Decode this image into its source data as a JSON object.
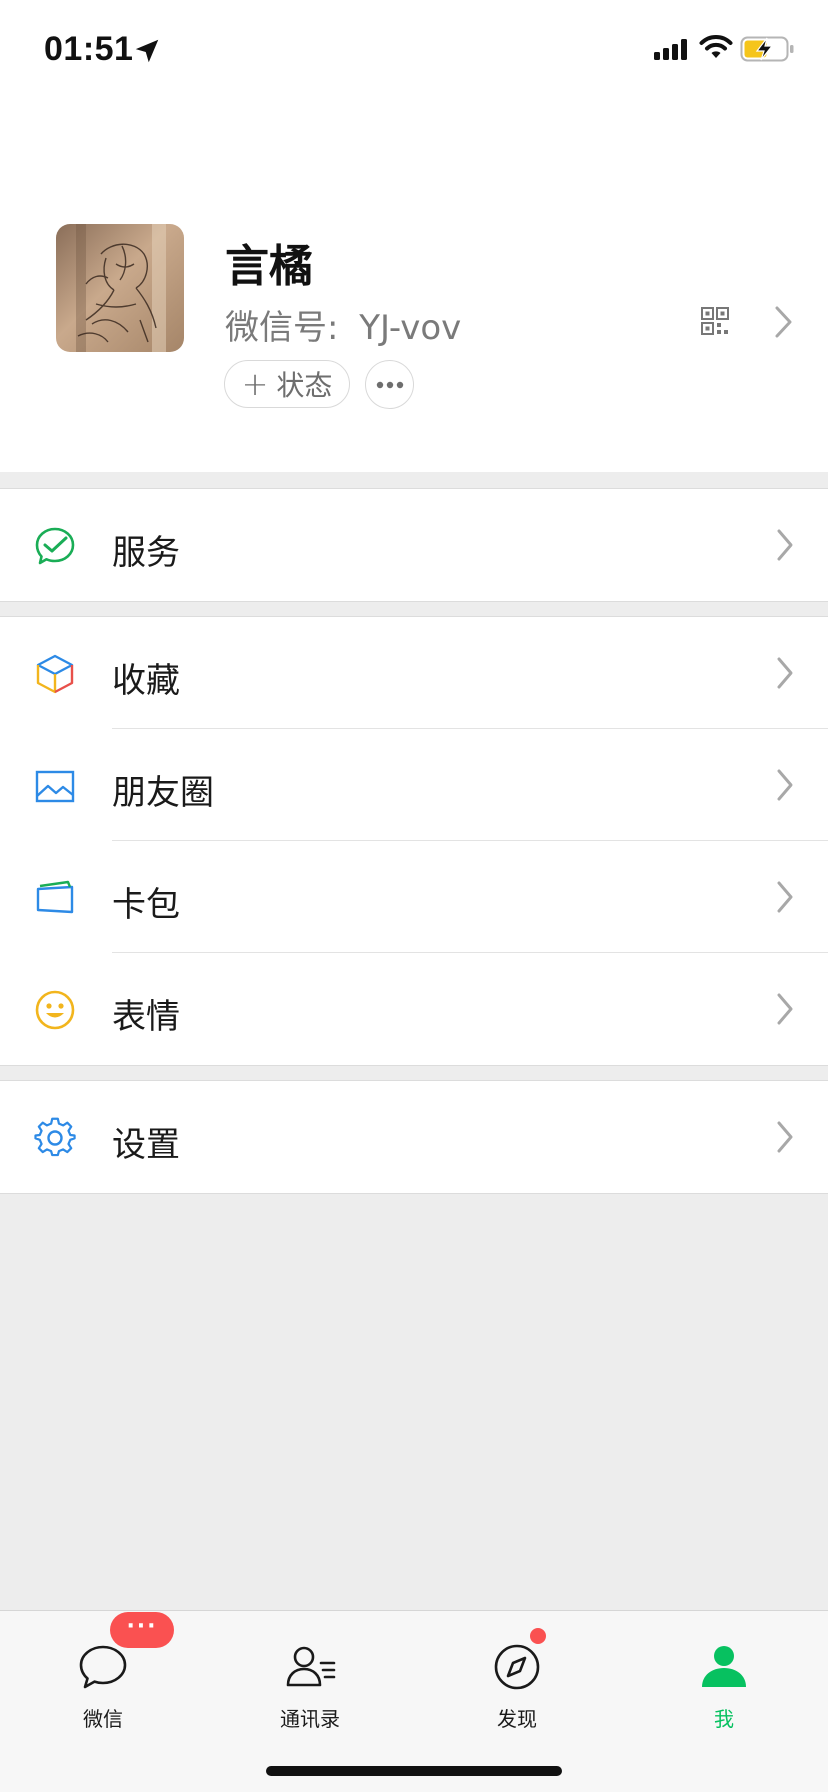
{
  "status_bar": {
    "time": "01:51"
  },
  "profile": {
    "nickname": "言橘",
    "wxid_label": "微信号:",
    "wxid_value": "YJ-vov",
    "status_button_label": "状态"
  },
  "menu": {
    "group1": [
      {
        "label": "服务",
        "icon": "wechat-pay-icon"
      }
    ],
    "group2": [
      {
        "label": "收藏",
        "icon": "favorites-cube-icon"
      },
      {
        "label": "朋友圈",
        "icon": "moments-picture-icon"
      },
      {
        "label": "卡包",
        "icon": "card-wallet-icon"
      },
      {
        "label": "表情",
        "icon": "smiley-icon"
      }
    ],
    "group3": [
      {
        "label": "设置",
        "icon": "gear-icon"
      }
    ]
  },
  "tabbar": {
    "chats_badge": "···",
    "tabs": [
      {
        "label": "微信",
        "icon": "chat-bubble-icon"
      },
      {
        "label": "通讯录",
        "icon": "contacts-icon"
      },
      {
        "label": "发现",
        "icon": "compass-icon"
      },
      {
        "label": "我",
        "icon": "person-icon",
        "active": true
      }
    ]
  },
  "colors": {
    "accent": "#07c160",
    "badge": "#fa5151",
    "background": "#ededed"
  }
}
